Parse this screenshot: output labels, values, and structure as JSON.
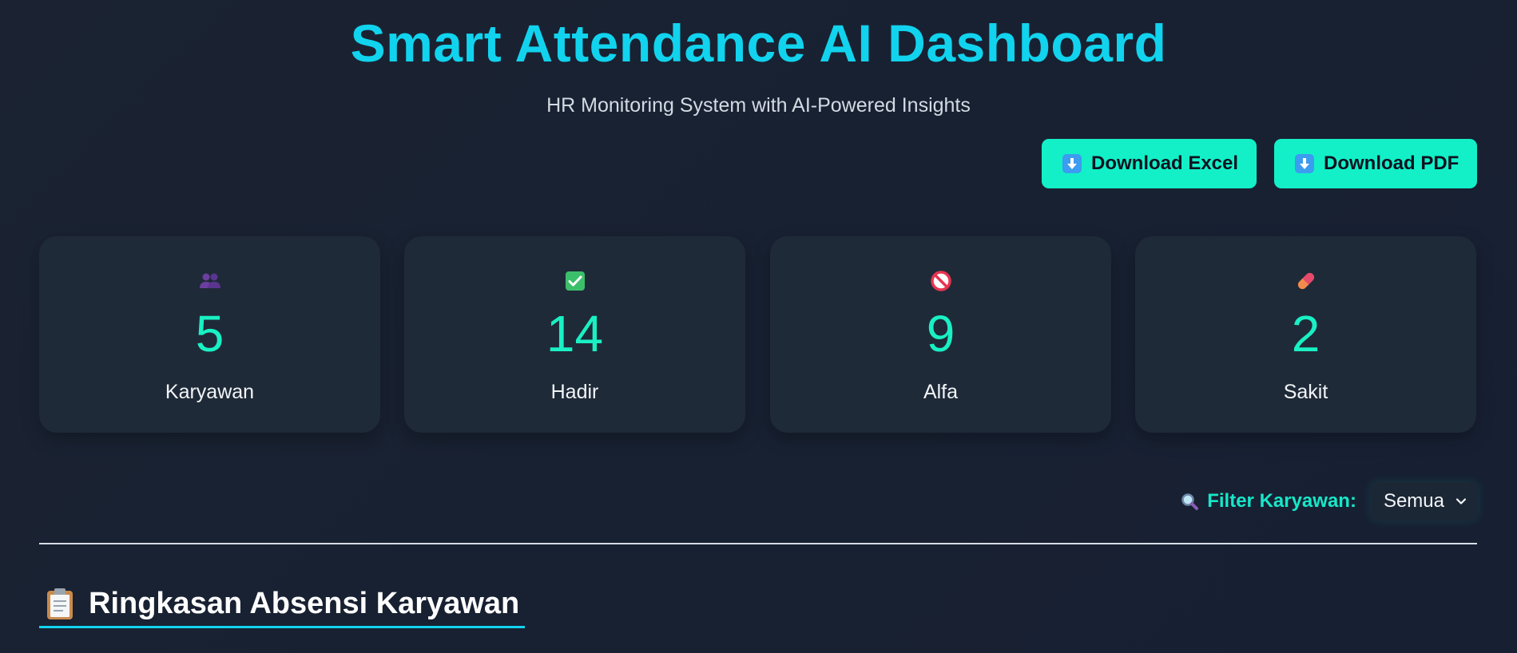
{
  "header": {
    "title": "Smart Attendance AI Dashboard",
    "subtitle": "HR Monitoring System with AI-Powered Insights"
  },
  "actions": {
    "download_excel": "Download Excel",
    "download_pdf": "Download PDF"
  },
  "stats": [
    {
      "icon": "people-icon",
      "value": "5",
      "label": "Karyawan"
    },
    {
      "icon": "check-icon",
      "value": "14",
      "label": "Hadir"
    },
    {
      "icon": "prohibited-icon",
      "value": "9",
      "label": "Alfa"
    },
    {
      "icon": "pill-icon",
      "value": "2",
      "label": "Sakit"
    }
  ],
  "filter": {
    "label": "Filter Karyawan:",
    "selected": "Semua"
  },
  "section": {
    "title": "Ringkasan Absensi Karyawan"
  },
  "colors": {
    "background": "#1a2333",
    "accent_cyan": "#11d3ee",
    "accent_teal": "#13f0c8",
    "card": "#1f2a38"
  }
}
